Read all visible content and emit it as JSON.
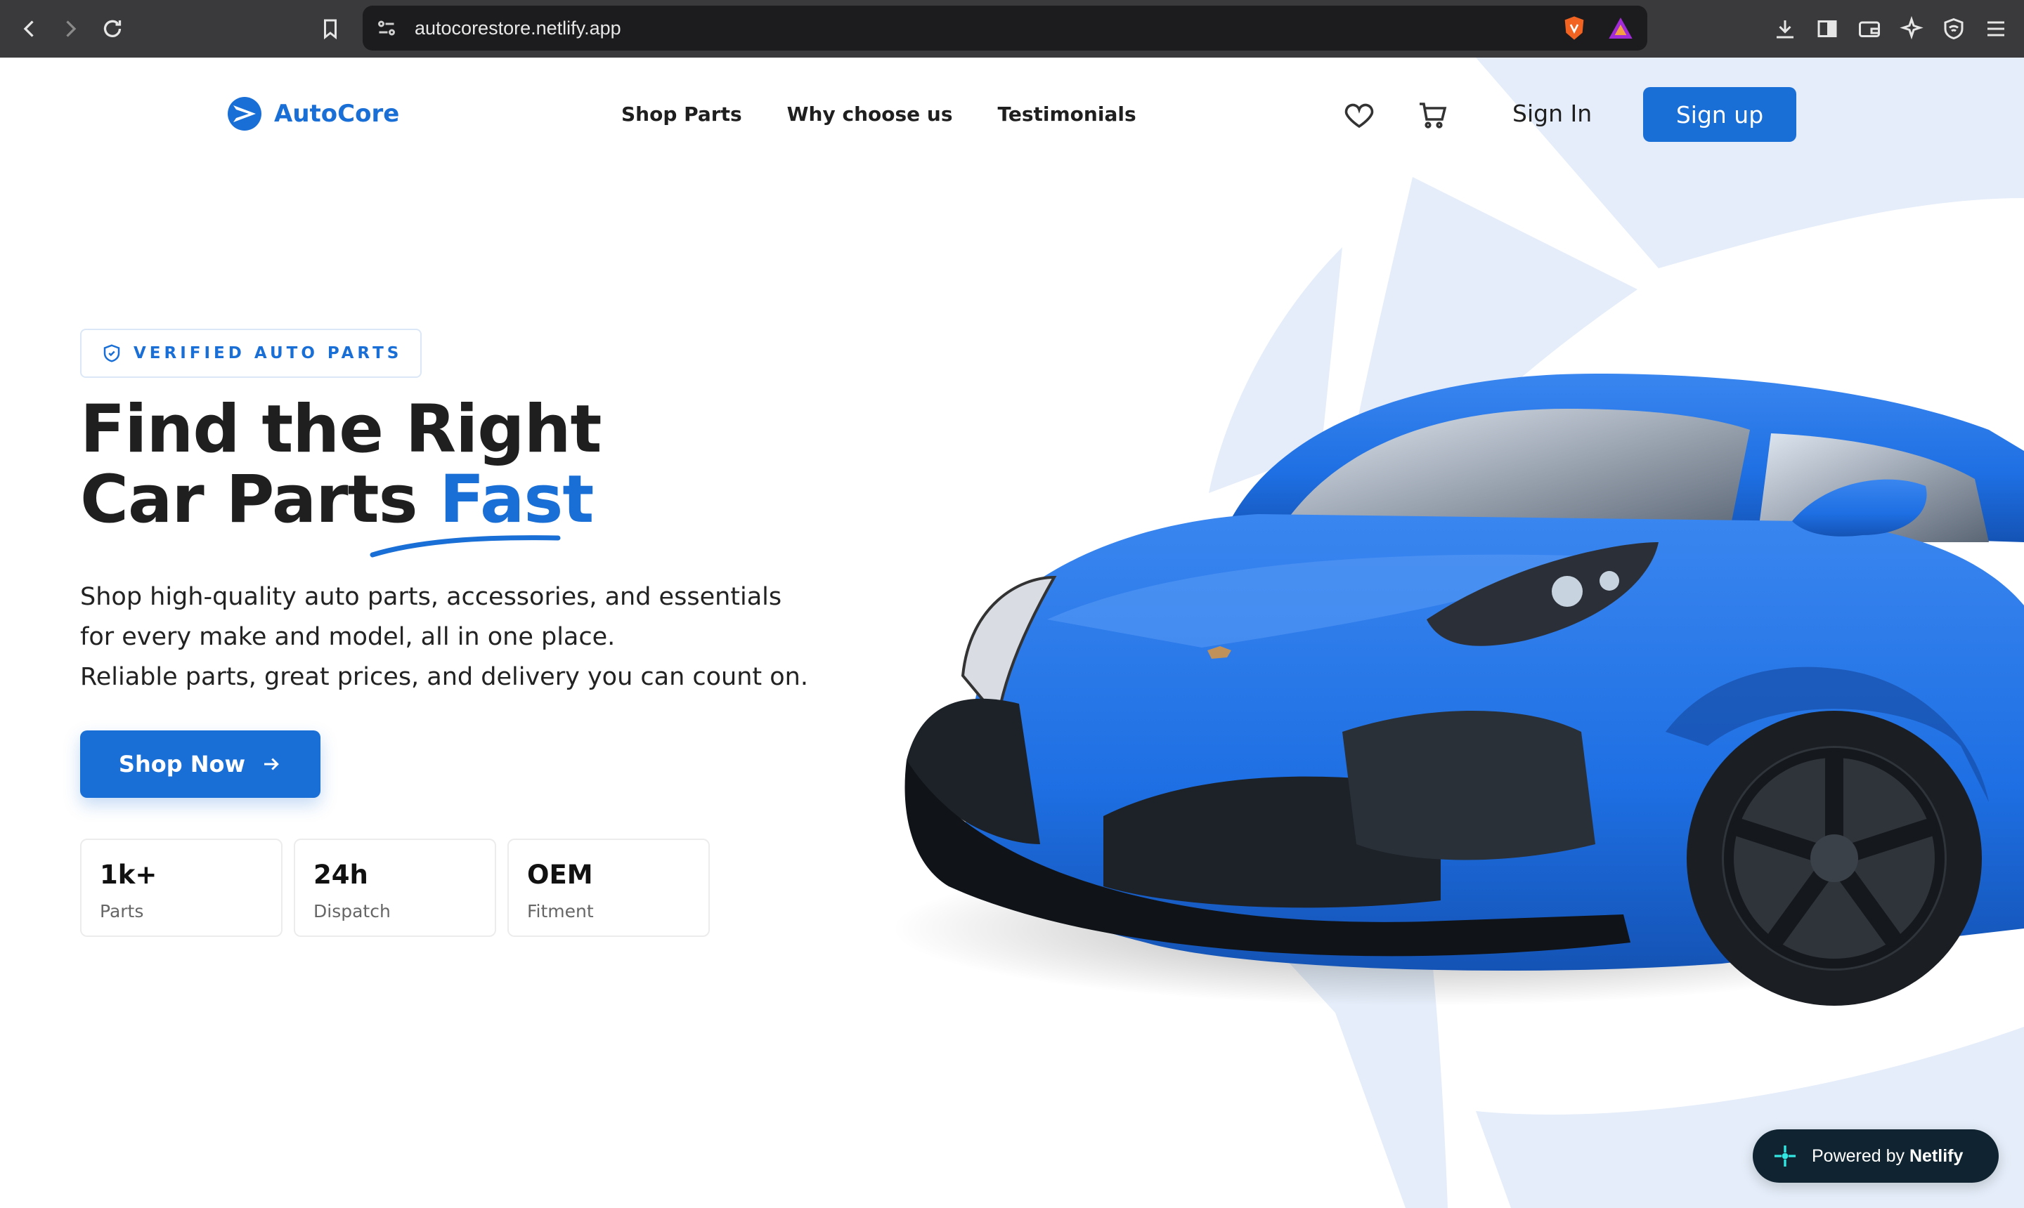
{
  "browser": {
    "url": "autocorestore.netlify.app"
  },
  "nav": {
    "brand": "AutoCore",
    "links": [
      "Shop Parts",
      "Why choose us",
      "Testimonials"
    ],
    "sign_in": "Sign In",
    "sign_up": "Sign up"
  },
  "hero": {
    "badge": "VERIFIED AUTO PARTS",
    "headline_line1": "Find the Right",
    "headline_line2_start": "Car Parts ",
    "headline_accent": "Fast",
    "description": [
      "Shop high-quality auto parts, accessories, and essentials",
      "for every make and model, all in one place.",
      "Reliable parts, great prices, and delivery you can count on."
    ],
    "cta": "Shop Now",
    "stats": [
      {
        "value": "1k+",
        "label": "Parts"
      },
      {
        "value": "24h",
        "label": "Dispatch"
      },
      {
        "value": "OEM",
        "label": "Fitment"
      }
    ]
  },
  "footer_badge": {
    "prefix": "Powered by ",
    "brand": "Netlify"
  },
  "colors": {
    "accent": "#1a6fd6",
    "shape": "#e4edf9",
    "car": "#1e6fe3"
  },
  "icons": [
    "back-icon",
    "forward-icon",
    "reload-icon",
    "bookmark-icon",
    "site-settings-icon",
    "brave-shield-icon",
    "brave-rewards-icon",
    "download-icon",
    "sidebar-icon",
    "wallet-icon",
    "leo-ai-icon",
    "vpn-icon",
    "menu-icon",
    "heart-icon",
    "cart-icon",
    "shield-check-icon",
    "arrow-right-icon",
    "netlify-icon"
  ]
}
